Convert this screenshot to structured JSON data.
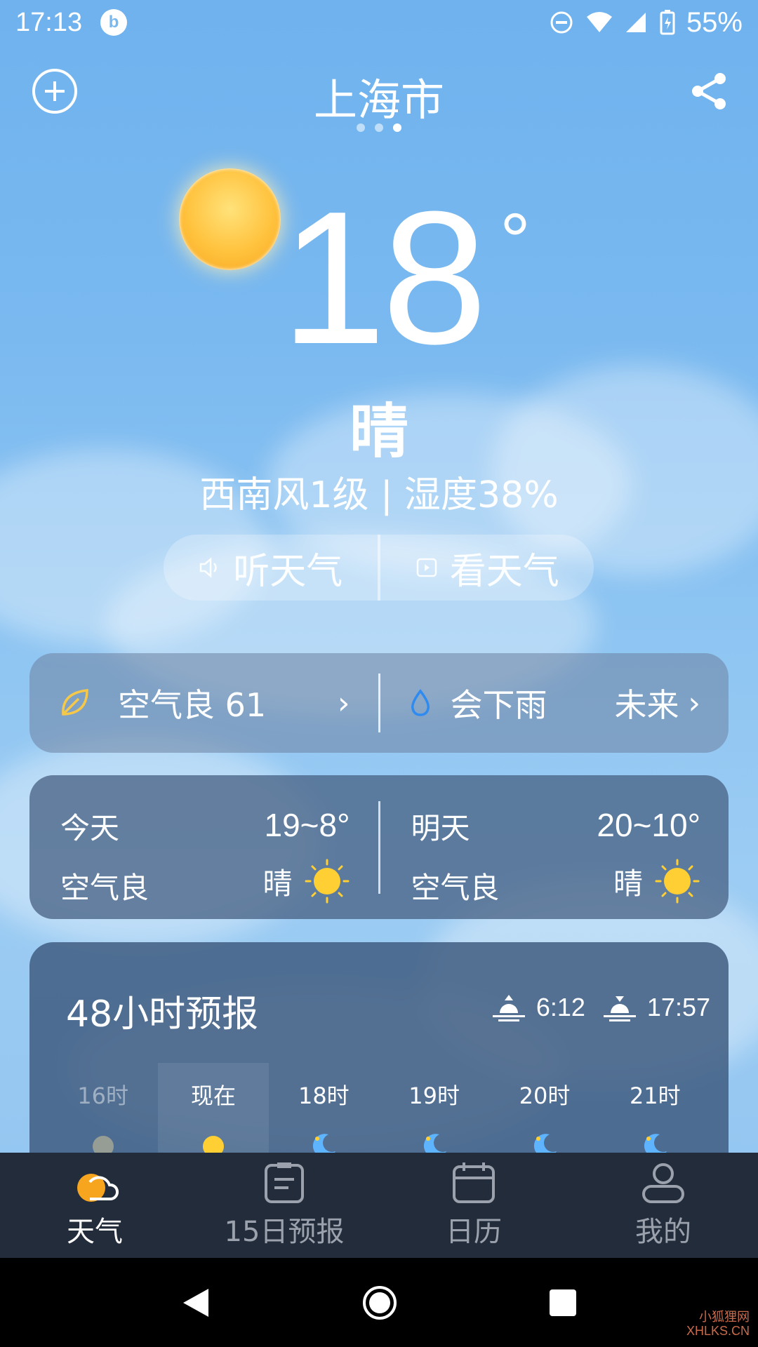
{
  "status_bar": {
    "time": "17:13",
    "battery": "55%"
  },
  "header": {
    "city": "上海市",
    "page_count": 3,
    "active_page": 3
  },
  "current": {
    "temperature": "18",
    "unit": "°",
    "condition": "晴",
    "wind_humidity": "西南风1级 | 湿度38%"
  },
  "actions": {
    "listen": "听天气",
    "watch": "看天气"
  },
  "air_row": {
    "air_quality": "空气良 61",
    "rain_text": "会下雨",
    "rain_time": "未来"
  },
  "today": {
    "label": "今天",
    "range": "19~8°",
    "air": "空气良",
    "condition": "晴"
  },
  "tomorrow": {
    "label": "明天",
    "range": "20~10°",
    "air": "空气良",
    "condition": "晴"
  },
  "forecast": {
    "title": "48小时预报",
    "sunrise": "6:12",
    "sunset": "17:57",
    "hours": [
      {
        "label": "16时",
        "icon": "sun-icon"
      },
      {
        "label": "现在",
        "icon": "sun-icon"
      },
      {
        "label": "18时",
        "icon": "moon-icon"
      },
      {
        "label": "19时",
        "icon": "moon-icon"
      },
      {
        "label": "20时",
        "icon": "moon-icon"
      },
      {
        "label": "21时",
        "icon": "moon-icon"
      }
    ]
  },
  "nav": {
    "weather": "天气",
    "forecast15": "15日预报",
    "calendar": "日历",
    "mine": "我的"
  },
  "watermark": {
    "cn": "小狐狸网",
    "en": "XHLKS.CN"
  },
  "colors": {
    "accent_sun": "#ffc23d",
    "nav_bg": "#222c3a",
    "card_bg": "#3c587d"
  }
}
